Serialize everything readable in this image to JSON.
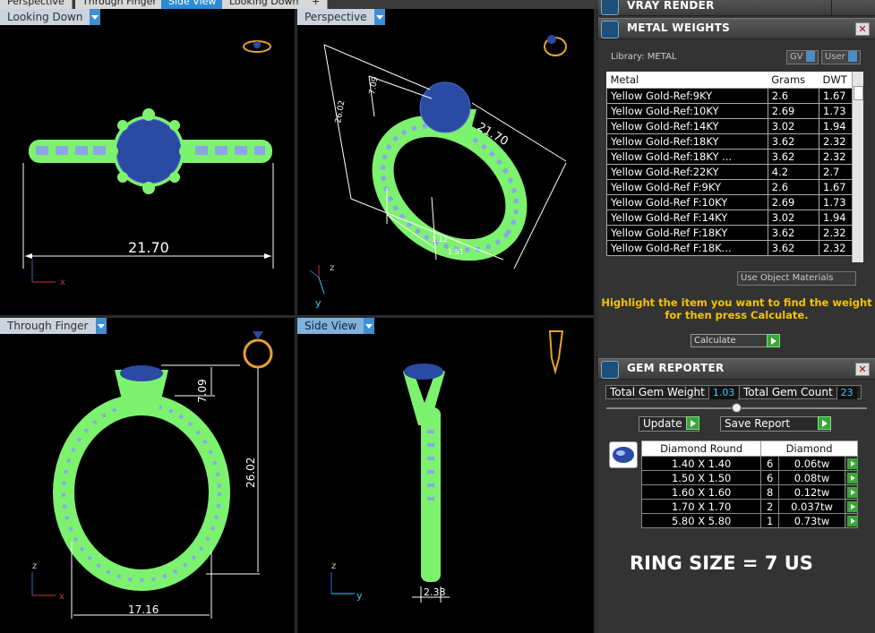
{
  "top_tabs": [
    "Perspective",
    "Through Finger",
    "Side View",
    "Looking Down"
  ],
  "viewports": {
    "tl": {
      "label": "Looking Down",
      "dim": "21.70"
    },
    "tr": {
      "label": "Perspective",
      "dim_top": "21.70",
      "dim_h": "7.09",
      "dim_v": "26.02",
      "dim_small": "1.12",
      "dim_small2": "1.51"
    },
    "bl": {
      "label": "Through Finger",
      "dim_h": "7.09",
      "dim_v": "26.02",
      "dim_w": "17.16"
    },
    "br": {
      "label": "Side View",
      "dim_w": "2.38"
    },
    "axes": {
      "x": "x",
      "y": "y",
      "z": "z"
    }
  },
  "vray": {
    "title": "VRAY RENDER"
  },
  "metal": {
    "title": "METAL WEIGHTS",
    "library": "Library: METAL",
    "gv": "GV",
    "user": "User",
    "headers": [
      "Metal",
      "Grams",
      "DWT"
    ],
    "rows": [
      [
        "Yellow Gold-Ref:9KY",
        "2.6",
        "1.67"
      ],
      [
        "Yellow Gold-Ref:10KY",
        "2.69",
        "1.73"
      ],
      [
        "Yellow Gold-Ref:14KY",
        "3.02",
        "1.94"
      ],
      [
        "Yellow Gold-Ref:18KY",
        "3.62",
        "2.32"
      ],
      [
        "Yellow Gold-Ref:18KY ...",
        "3.62",
        "2.32"
      ],
      [
        "Yellow Gold-Ref:22KY",
        "4.2",
        "2.7"
      ],
      [
        "Yellow Gold-Ref F:9KY",
        "2.6",
        "1.67"
      ],
      [
        "Yellow Gold-Ref F:10KY",
        "2.69",
        "1.73"
      ],
      [
        "Yellow Gold-Ref F:14KY",
        "3.02",
        "1.94"
      ],
      [
        "Yellow Gold-Ref F:18KY",
        "3.62",
        "2.32"
      ],
      [
        "Yellow Gold-Ref F:18K...",
        "3.62",
        "2.32"
      ]
    ],
    "use_object_materials": "Use Object Materials",
    "hint": "Highlight the item you want to find the weight for then press Calculate.",
    "calculate": "Calculate"
  },
  "gem": {
    "title": "GEM REPORTER",
    "total_weight_label": "Total Gem Weight",
    "total_weight": "1.03",
    "total_count_label": "Total Gem Count",
    "total_count": "23",
    "update": "Update",
    "save_report": "Save Report",
    "headers": [
      "Diamond Round",
      "Diamond"
    ],
    "rows": [
      [
        "1.40 X 1.40",
        "6",
        "0.06tw"
      ],
      [
        "1.50 X 1.50",
        "6",
        "0.08tw"
      ],
      [
        "1.60 X 1.60",
        "8",
        "0.12tw"
      ],
      [
        "1.70 X 1.70",
        "2",
        "0.037tw"
      ],
      [
        "5.80 X 5.80",
        "1",
        "0.73tw"
      ]
    ],
    "ring_size": "RING SIZE = 7 US"
  },
  "colors": {
    "band": "#7df26f",
    "gem": "#2b4aa3",
    "accent": "#2e8bd6",
    "hint": "#f5c400"
  }
}
